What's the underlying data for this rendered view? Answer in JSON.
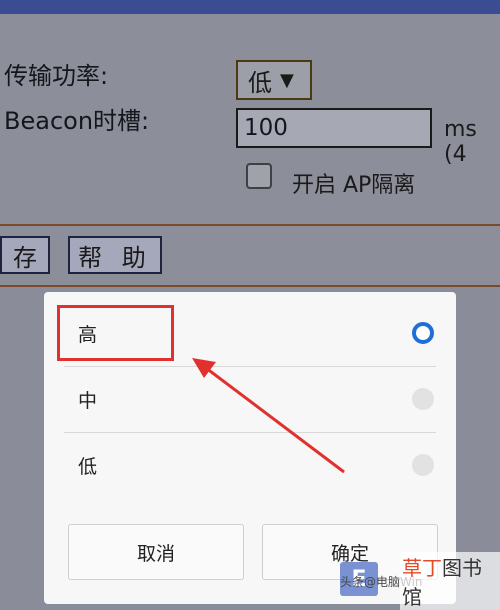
{
  "form": {
    "power_label": "传输功率:",
    "power_value": "低",
    "beacon_label": "Beacon时槽:",
    "beacon_value": "100",
    "beacon_unit": "ms (4",
    "ap_isolation_label": "开启 AP隔离"
  },
  "buttons": {
    "save_label": "存",
    "help_label": "帮 助"
  },
  "dialog": {
    "options": [
      {
        "label": "高",
        "selected": true
      },
      {
        "label": "中",
        "selected": false
      },
      {
        "label": "低",
        "selected": false
      }
    ],
    "cancel_label": "取消",
    "ok_label": "确定"
  },
  "annotation": {
    "color": "#e0312f"
  },
  "watermark": {
    "source": "头条@电脑Win",
    "brand_highlight": "草丁",
    "brand_rest": "图书馆"
  },
  "colors": {
    "accent": "#1f6fd6",
    "topbar": "#3c4c93"
  }
}
